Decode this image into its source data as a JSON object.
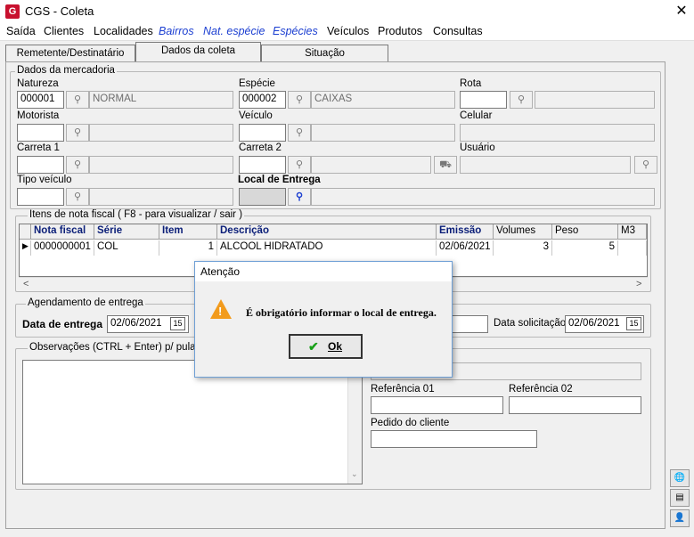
{
  "window": {
    "title": "CGS - Coleta",
    "app_icon": "G",
    "close_glyph": "✕"
  },
  "menu": [
    "Saída",
    "Clientes",
    "Localidades",
    "Bairros",
    "Nat. espécie",
    "Espécies",
    "Veículos",
    "Produtos",
    "Consultas"
  ],
  "tabs": [
    "Remetente/Destinatário",
    "Dados da coleta",
    "Situação"
  ],
  "mercadoria": {
    "legend": "Dados da mercadoria",
    "natureza_label": "Natureza",
    "natureza_code": "000001",
    "natureza_desc": "NORMAL",
    "especie_label": "Espécie",
    "especie_code": "000002",
    "especie_desc": "CAIXAS",
    "rota_label": "Rota",
    "motorista_label": "Motorista",
    "veiculo_label": "Veículo",
    "celular_label": "Celular",
    "carreta1_label": "Carreta 1",
    "carreta2_label": "Carreta 2",
    "usuario_label": "Usuário",
    "tipo_veiculo_label": "Tipo veículo",
    "local_entrega_label": "Local de Entrega"
  },
  "itens": {
    "legend": "Itens de nota fiscal ( F8 - para visualizar / sair )",
    "headers": [
      "Nota fiscal",
      "Série",
      "Item",
      "Descrição",
      "Emissão",
      "Volumes",
      "Peso",
      "M3"
    ],
    "row": [
      "0000000001",
      "COL",
      "1",
      "ALCOOL HIDRATADO",
      "02/06/2021",
      "3",
      "5",
      ""
    ]
  },
  "agendamento": {
    "legend": "Agendamento de entrega",
    "data_entrega_label": "Data de entrega",
    "data_entrega_value": "02/06/2021",
    "data_solicitacao_label": "Data solicitação",
    "data_solicitacao_value": "02/06/2021",
    "calendar_glyph": "15"
  },
  "observacoes": {
    "legend": "Observações (CTRL + Enter) p/ pular li"
  },
  "referencias": {
    "ref1_label": "Referência 01",
    "ref2_label": "Referência 02",
    "pedido_label": "Pedido do cliente"
  },
  "dialog": {
    "title": "Atenção",
    "message": "É obrigatório informar o local de entrega.",
    "ok_label": "Ok",
    "ok_check": "✔"
  },
  "colors": {
    "menu_blue": "#1c3fd1",
    "warning": "#f29b1d",
    "header_blue": "#0a1e78"
  }
}
